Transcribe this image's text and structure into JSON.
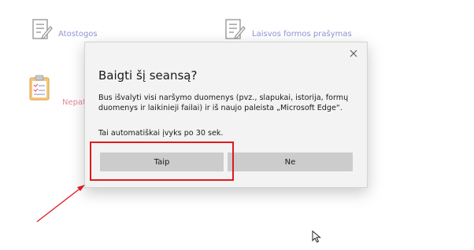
{
  "background": {
    "tiles": [
      {
        "label": "Atostogos",
        "icon": "form-icon"
      },
      {
        "label": "Laisvos formos prašymas",
        "icon": "form-icon"
      },
      {
        "label": "Nepat",
        "icon": "clipboard-icon"
      }
    ]
  },
  "dialog": {
    "title": "Baigti šį seansą?",
    "body": "Bus išvalyti visi naršymo duomenys (pvz., slapukai, istorija, formų duomenys ir laikinieji failai) ir iš naujo paleista „Microsoft Edge“.",
    "countdown": "Tai automatiškai įvyks po 30 sek.",
    "yes_label": "Taip",
    "no_label": "Ne",
    "close_icon": "close-icon"
  },
  "annotation": {
    "color": "#e0191e"
  },
  "colors": {
    "link": "#8f93d6",
    "link_red": "#e58a9a",
    "button": "#cccccc",
    "dialog_bg": "#f3f3f3"
  }
}
